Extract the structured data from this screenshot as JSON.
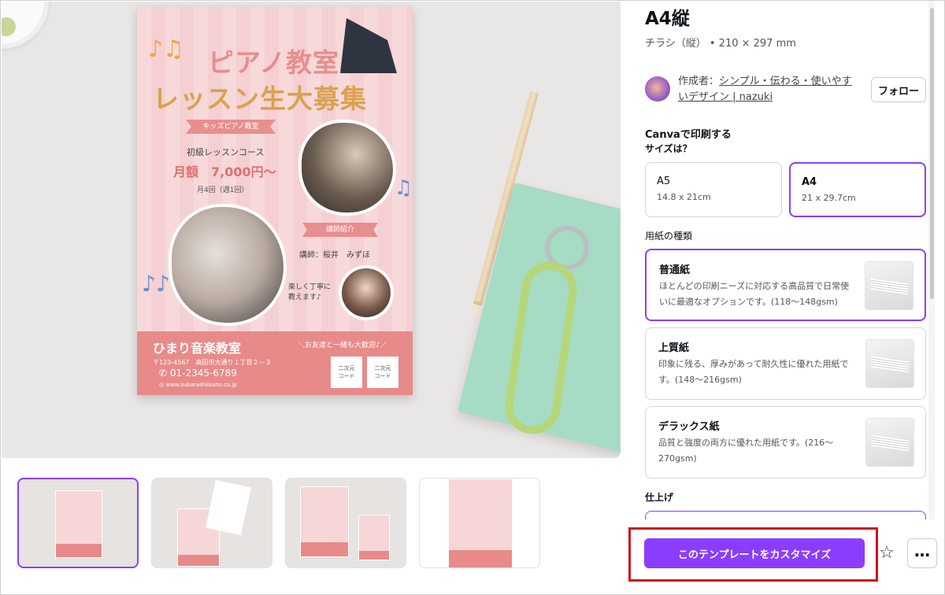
{
  "flyer": {
    "title_line1": "ピアノ教室",
    "title_line2": "レッスン生大募集",
    "ribbon1": "キッズピアノ教室",
    "course": "初級レッスンコース",
    "price": "月額　7,000円～",
    "freq": "月4回（週1回）",
    "ribbon2": "講師紹介",
    "teacher": "講師：桜井　みずほ",
    "talk": "楽しく丁寧に\n教えます♪",
    "school": "ひまり音楽教室",
    "address": "〒123-4567　高田市大通り１丁目２－３",
    "tel": "01-2345-6789",
    "url": "www.subarashiisaito.co.jp",
    "welcome": "＼お友達と一緒も大歓迎♪／",
    "qr1": "二次元\nコード",
    "qr2": "二次元\nコード"
  },
  "sidebar": {
    "title": "A4縦",
    "subtitle": "チラシ（縦） • 210 × 297 mm",
    "author_prefix": "作成者：",
    "author_name": "シンプル・伝わる・使いやすいデザイン | nazuki",
    "follow": "フォロー",
    "print_heading": "Canvaで印刷する",
    "size_question": "サイズは？",
    "sizes": [
      {
        "name": "A5",
        "dim": "14.8 x 21cm"
      },
      {
        "name": "A4",
        "dim": "21 x 29.7cm"
      }
    ],
    "paper_heading": "用紙の種類",
    "papers": [
      {
        "name": "普通紙",
        "desc": "ほとんどの印刷ニーズに対応する高品質で日常使いに最適なオプションです。(118〜148gsm)"
      },
      {
        "name": "上質紙",
        "desc": "印象に残る、厚みがあって耐久性に優れた用紙です。(148〜216gsm)"
      },
      {
        "name": "デラックス紙",
        "desc": "品質と強度の両方に優れた用紙です。(216〜270gsm)"
      }
    ],
    "finish_heading": "仕上げ"
  },
  "actions": {
    "customize": "このテンプレートをカスタマイズ",
    "star_icon": "☆",
    "more_icon": "…"
  },
  "colors": {
    "accent": "#8b3dff",
    "highlight": "#c8161d"
  }
}
